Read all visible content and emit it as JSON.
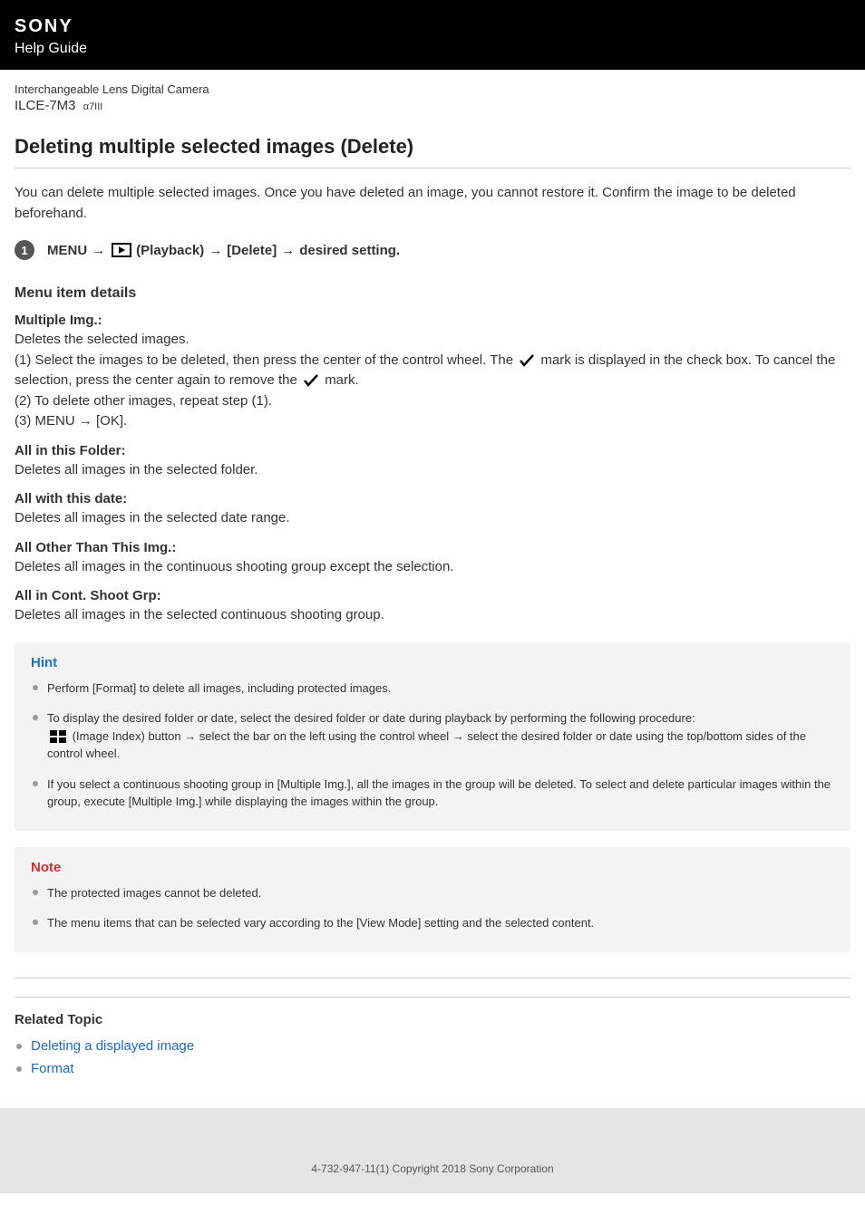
{
  "header": {
    "brand": "SONY",
    "guide": "Help Guide"
  },
  "product": {
    "line1": "Interchangeable Lens Digital Camera",
    "model": "ILCE-7M3",
    "sub": "α7III"
  },
  "page": {
    "title": "Deleting multiple selected images (Delete)",
    "intro": "You can delete multiple selected images. Once you have deleted an image, you cannot restore it. Confirm the image to be deleted beforehand."
  },
  "step": {
    "num": "1",
    "menu": "MENU",
    "playback": "(Playback)",
    "delete": "[Delete]",
    "setting": "desired setting."
  },
  "details": {
    "heading": "Menu item details",
    "items": [
      {
        "title": "Multiple Img.:",
        "desc_intro": "Deletes the selected images.",
        "line1_a": "(1) Select the images to be deleted, then press the center of the control wheel. The ",
        "line1_b": " mark is displayed in the check box. To cancel the selection, press the center again to remove the ",
        "line1_c": " mark.",
        "line2": "(2) To delete other images, repeat step (1).",
        "line3": "(3) MENU → [OK]."
      },
      {
        "title": "All in this Folder:",
        "desc": "Deletes all images in the selected folder."
      },
      {
        "title": "All with this date:",
        "desc": "Deletes all images in the selected date range."
      },
      {
        "title": "All Other Than This Img.:",
        "desc": "Deletes all images in the continuous shooting group except the selection."
      },
      {
        "title": "All in Cont. Shoot Grp:",
        "desc": "Deletes all images in the selected continuous shooting group."
      }
    ]
  },
  "hint": {
    "title": "Hint",
    "items": [
      "Perform [Format] to delete all images, including protected images.",
      {
        "pre": "To display the desired folder or date, select the desired folder or date during playback by performing the following procedure:",
        "post": " (Image Index) button → select the bar on the left using the control wheel → select the desired folder or date using the top/bottom sides of the control wheel."
      },
      "If you select a continuous shooting group in [Multiple Img.], all the images in the group will be deleted. To select and delete particular images within the group, execute [Multiple Img.] while displaying the images within the group."
    ]
  },
  "note": {
    "title": "Note",
    "items": [
      "The protected images cannot be deleted.",
      "The menu items that can be selected vary according to the [View Mode] setting and the selected content."
    ]
  },
  "related": {
    "title": "Related Topic",
    "links": [
      "Deleting a displayed image",
      "Format"
    ]
  },
  "footer": {
    "copyright": "4-732-947-11(1) Copyright 2018 Sony Corporation"
  }
}
